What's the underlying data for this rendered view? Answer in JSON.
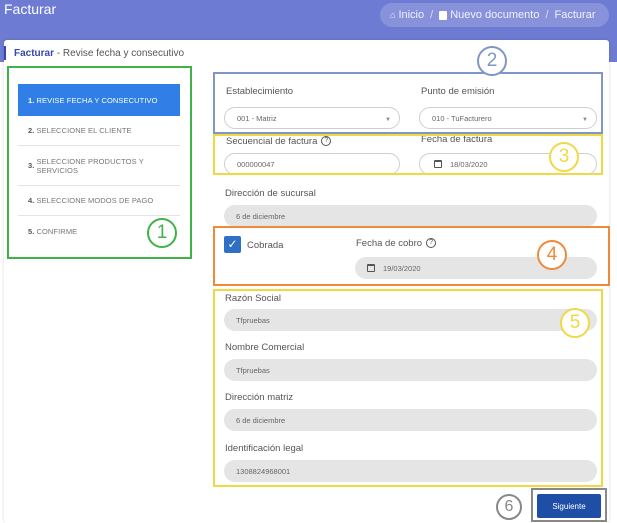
{
  "header": {
    "title": "Facturar",
    "breadcrumb": [
      "Inicio",
      "Nuevo documento",
      "Facturar"
    ],
    "background_color": "#6d7bd3"
  },
  "card": {
    "title": "Facturar",
    "subtitle": "Revise fecha y consecutivo"
  },
  "steps": [
    {
      "num": "1.",
      "label": "REVISE FECHA Y CONSECUTIVO",
      "active": true
    },
    {
      "num": "2.",
      "label": "SELECCIONE EL CLIENTE",
      "active": false
    },
    {
      "num": "3.",
      "label": "SELECCIONE PRODUCTOS Y SERVICIOS",
      "active": false
    },
    {
      "num": "4.",
      "label": "SELECCIONE MODOS DE PAGO",
      "active": false
    },
    {
      "num": "5.",
      "label": "CONFIRME",
      "active": false
    }
  ],
  "form": {
    "establecimiento": {
      "label": "Establecimiento",
      "value": "001 - Matriz"
    },
    "punto_emision": {
      "label": "Punto de emisión",
      "value": "010 - TuFacturero"
    },
    "secuencial": {
      "label": "Secuencial de factura",
      "value": "000000047"
    },
    "fecha_factura": {
      "label": "Fecha de factura",
      "value": "18/03/2020"
    },
    "direccion_sucursal": {
      "label": "Dirección de sucursal",
      "value": "6 de diciembre"
    },
    "cobrada": {
      "label": "Cobrada",
      "checked": true
    },
    "fecha_cobro": {
      "label": "Fecha de cobro",
      "value": "19/03/2020"
    },
    "razon_social": {
      "label": "Razón Social",
      "value": "Tfpruebas"
    },
    "nombre_comercial": {
      "label": "Nombre Comercial",
      "value": "Tfpruebas"
    },
    "direccion_matriz": {
      "label": "Dirección matriz",
      "value": "6 de diciembre"
    },
    "identificacion_legal": {
      "label": "Identificación legal",
      "value": "1308824968001"
    }
  },
  "buttons": {
    "next": "Siguiente"
  },
  "annotations": [
    "1",
    "2",
    "3",
    "4",
    "5",
    "6"
  ],
  "colors": {
    "accent": "#2f7fe6",
    "primary_button": "#1f4ea6",
    "annotation_green": "#3fb34a",
    "annotation_blue": "#7f97c4",
    "annotation_yellow": "#f1d845",
    "annotation_orange": "#ef8a3b",
    "annotation_grey": "#888888"
  }
}
